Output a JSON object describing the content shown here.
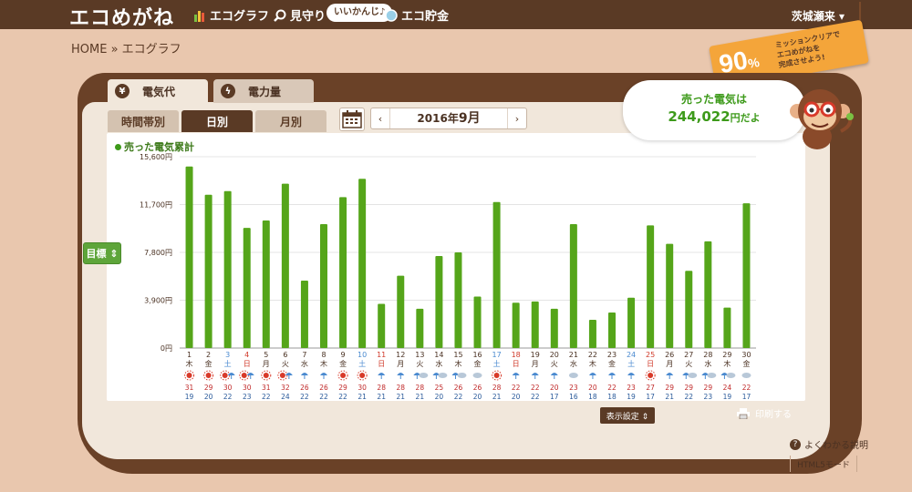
{
  "header": {
    "logo": "エコめがね",
    "nav": [
      {
        "label": "エコグラフ",
        "icon": "bar-chart-icon"
      },
      {
        "label": "見守り",
        "icon": "magnifier-icon"
      },
      {
        "label": "エコ貯金",
        "icon": "coin-icon"
      }
    ],
    "speech": "いいかんじ♪",
    "user": "茨城瀬来 ▾"
  },
  "breadcrumb": "HOME » エコグラフ",
  "mission": {
    "percent": "90",
    "percent_unit": "%",
    "line1": "ミッションクリアで",
    "line2": "エコめがねを",
    "line3": "完成させよう!"
  },
  "tabs": {
    "money": {
      "label": "電気代",
      "icon": "yen-icon"
    },
    "power": {
      "label": "電力量",
      "icon": "bolt-icon"
    }
  },
  "subtabs": {
    "hourly": "時間帯別",
    "daily": "日別",
    "monthly": "月別"
  },
  "month_nav": {
    "prev": "‹",
    "year": "2016年",
    "month": "9月",
    "next": "›"
  },
  "sold": {
    "title": "売った電気は",
    "value": "244,022",
    "unit": "円だよ"
  },
  "goal_button": "目標 ⇕",
  "display_settings": "表示設定 ⇕",
  "print": "印刷する",
  "help": "よくわかる説明",
  "html5": "HTML5モード",
  "colors": {
    "bar": "#55a51a",
    "sat": "#4a8ad0",
    "sun": "#d03a2a",
    "weekday": "#4a3122",
    "high": "#c02a2a",
    "low": "#2a5a9a"
  },
  "chart_data": {
    "type": "bar",
    "legend": "売った電気累計",
    "ylim": [
      0,
      15600
    ],
    "yticks": [
      "0円",
      "3,900円",
      "7,800円",
      "11,700円",
      "15,600円"
    ],
    "categories": [
      "1",
      "2",
      "3",
      "4",
      "5",
      "6",
      "7",
      "8",
      "9",
      "10",
      "11",
      "12",
      "13",
      "14",
      "15",
      "16",
      "17",
      "18",
      "19",
      "20",
      "21",
      "22",
      "23",
      "24",
      "25",
      "26",
      "27",
      "28",
      "29",
      "30"
    ],
    "weekdays": [
      "木",
      "金",
      "土",
      "日",
      "月",
      "火",
      "水",
      "木",
      "金",
      "土",
      "日",
      "月",
      "火",
      "水",
      "木",
      "金",
      "土",
      "日",
      "月",
      "火",
      "水",
      "木",
      "金",
      "土",
      "日",
      "月",
      "火",
      "水",
      "木",
      "金"
    ],
    "weather": [
      "sun",
      "sun",
      "sun-umbrella",
      "sun-umbrella",
      "sun",
      "sun-umbrella",
      "umbrella",
      "umbrella",
      "sun",
      "sun",
      "umbrella",
      "umbrella",
      "umbrella-cloud",
      "umbrella-cloud",
      "umbrella-cloud",
      "cloud",
      "sun",
      "umbrella",
      "umbrella",
      "umbrella",
      "cloud",
      "umbrella",
      "umbrella",
      "umbrella",
      "sun",
      "umbrella",
      "umbrella-cloud",
      "umbrella-cloud",
      "umbrella-cloud",
      "cloud"
    ],
    "high_temps": [
      "31",
      "29",
      "30",
      "30",
      "31",
      "32",
      "26",
      "26",
      "29",
      "30",
      "28",
      "28",
      "28",
      "25",
      "26",
      "26",
      "28",
      "22",
      "22",
      "20",
      "23",
      "20",
      "22",
      "23",
      "27",
      "29",
      "29",
      "29",
      "24",
      "22"
    ],
    "low_temps": [
      "19",
      "20",
      "22",
      "23",
      "22",
      "24",
      "22",
      "22",
      "22",
      "21",
      "21",
      "21",
      "21",
      "20",
      "22",
      "20",
      "21",
      "20",
      "22",
      "17",
      "16",
      "18",
      "18",
      "19",
      "17",
      "21",
      "22",
      "23",
      "19",
      "17"
    ],
    "values": [
      14800,
      12500,
      12800,
      9800,
      10400,
      13400,
      5500,
      10100,
      12300,
      13800,
      3600,
      5900,
      3200,
      7500,
      7800,
      4200,
      11900,
      3700,
      3800,
      3200,
      10100,
      2300,
      2900,
      4100,
      10000,
      8500,
      6300,
      8700,
      3300,
      11800
    ]
  }
}
